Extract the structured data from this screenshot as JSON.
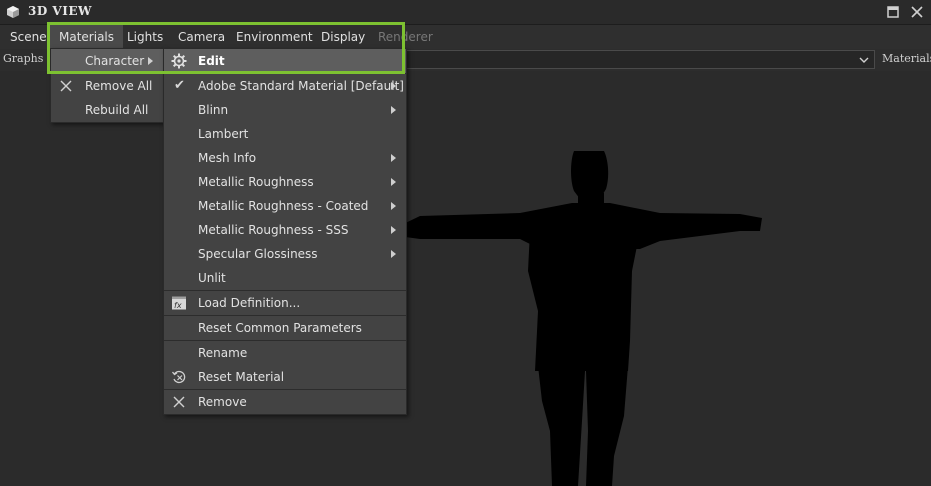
{
  "titlebar": {
    "title": "3D VIEW",
    "icons": [
      "cube-icon",
      "restore-window-icon",
      "close-icon"
    ]
  },
  "menubar": {
    "items": [
      "Scene",
      "Materials",
      "Lights",
      "Camera",
      "Environment",
      "Display",
      "Renderer"
    ],
    "active": "Materials"
  },
  "graphbar": {
    "label": "Graphs :",
    "selected": "",
    "right_label": "Materials"
  },
  "materials_menu": {
    "items": [
      {
        "label": "Character",
        "has_submenu": true,
        "highlighted": true
      },
      {
        "label": "Remove All",
        "icon": "x-icon"
      },
      {
        "label": "Rebuild All"
      }
    ]
  },
  "character_submenu": {
    "items": [
      {
        "label": "Edit",
        "icon": "gear-icon",
        "highlighted": true
      },
      {
        "label": "Adobe Standard Material [Default]",
        "checked": true,
        "has_submenu": true
      },
      {
        "label": "Blinn",
        "has_submenu": true
      },
      {
        "label": "Lambert"
      },
      {
        "label": "Mesh Info",
        "has_submenu": true
      },
      {
        "label": "Metallic Roughness",
        "has_submenu": true
      },
      {
        "label": "Metallic Roughness - Coated",
        "has_submenu": true
      },
      {
        "label": "Metallic Roughness - SSS",
        "has_submenu": true
      },
      {
        "label": "Specular Glossiness",
        "has_submenu": true
      },
      {
        "label": "Unlit"
      },
      {
        "label": "Load Definition...",
        "icon": "fx-icon"
      },
      {
        "label": "Reset Common Parameters"
      },
      {
        "label": "Rename"
      },
      {
        "label": "Reset Material",
        "icon": "reset-icon"
      },
      {
        "label": "Remove",
        "icon": "x-icon"
      }
    ]
  },
  "colors": {
    "highlight_border": "#7dc131",
    "menu_bg": "#434343",
    "viewport_bg": "#2b2b2b"
  }
}
